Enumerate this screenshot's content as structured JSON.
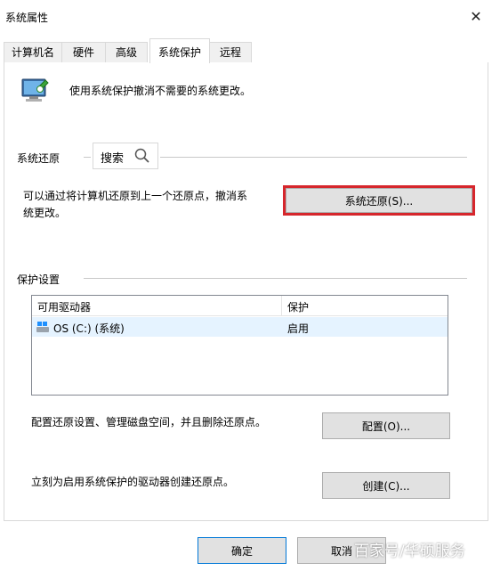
{
  "window": {
    "title": "系统属性"
  },
  "tabs": [
    {
      "label": "计算机名"
    },
    {
      "label": "硬件"
    },
    {
      "label": "高级"
    },
    {
      "label": "系统保护"
    },
    {
      "label": "远程"
    }
  ],
  "intro": {
    "text": "使用系统保护撤消不需要的系统更改。",
    "icon": "system-protection-icon"
  },
  "restore": {
    "group_label": "系统还原",
    "description_line1": "可以通过将计算机还原到上一个还原点，撤消系",
    "description_line2": "统更改。",
    "button_label": "系统还原(S)...",
    "search_overlay_label": "搜索",
    "highlight_color": "#d6262c"
  },
  "protection": {
    "group_label": "保护设置",
    "columns": [
      "可用驱动器",
      "保护"
    ],
    "rows": [
      {
        "drive": "OS (C:) (系统)",
        "status": "启用",
        "icon": "windows-drive-icon"
      }
    ],
    "configure_text": "配置还原设置、管理磁盘空间，并且删除还原点。",
    "configure_button": "配置(O)...",
    "create_text": "立刻为启用系统保护的驱动器创建还原点。",
    "create_button": "创建(C)..."
  },
  "footer": {
    "ok_button": "确定",
    "cancel_button": "取消",
    "watermark": "百家号/华硕服务"
  }
}
